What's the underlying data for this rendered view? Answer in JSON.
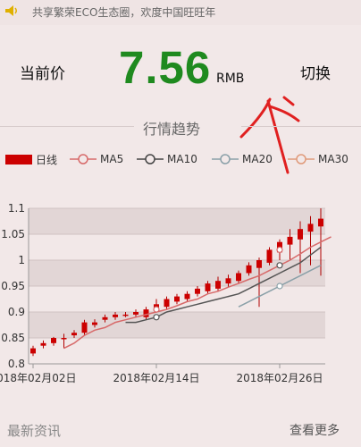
{
  "banner": {
    "text": "共享繁荣ECO生态圈，欢度中国旺旺年"
  },
  "price": {
    "label": "当前价",
    "value": "7.56",
    "unit": "RMB",
    "switch_label": "切换"
  },
  "section": {
    "title": "行情趋势"
  },
  "legend": [
    {
      "label": "日线",
      "color": "#cc0000",
      "kind": "bar"
    },
    {
      "label": "MA5",
      "color": "#d76a6a",
      "kind": "line"
    },
    {
      "label": "MA10",
      "color": "#444444",
      "kind": "line"
    },
    {
      "label": "MA20",
      "color": "#8aa0a8",
      "kind": "line"
    },
    {
      "label": "MA30",
      "color": "#e09a7a",
      "kind": "line"
    }
  ],
  "chart_data": {
    "type": "candlestick",
    "ylim": [
      0.8,
      1.1
    ],
    "yticks": [
      "1.1",
      "1.05",
      "1",
      "0.95",
      "0.9",
      "0.85",
      "0.8"
    ],
    "xticks": [
      {
        "index": 0,
        "label": "2018年02月02日"
      },
      {
        "index": 12,
        "label": "2018年02月14日"
      },
      {
        "index": 24,
        "label": "2018年02月26日"
      }
    ],
    "candles": [
      {
        "o": 0.82,
        "c": 0.83,
        "h": 0.835,
        "l": 0.815
      },
      {
        "o": 0.835,
        "c": 0.84,
        "h": 0.845,
        "l": 0.83
      },
      {
        "o": 0.84,
        "c": 0.85,
        "h": 0.852,
        "l": 0.835
      },
      {
        "o": 0.85,
        "c": 0.85,
        "h": 0.858,
        "l": 0.83
      },
      {
        "o": 0.855,
        "c": 0.86,
        "h": 0.865,
        "l": 0.85
      },
      {
        "o": 0.86,
        "c": 0.88,
        "h": 0.885,
        "l": 0.855
      },
      {
        "o": 0.875,
        "c": 0.88,
        "h": 0.886,
        "l": 0.87
      },
      {
        "o": 0.885,
        "c": 0.89,
        "h": 0.895,
        "l": 0.88
      },
      {
        "o": 0.89,
        "c": 0.895,
        "h": 0.9,
        "l": 0.885
      },
      {
        "o": 0.895,
        "c": 0.895,
        "h": 0.9,
        "l": 0.89
      },
      {
        "o": 0.895,
        "c": 0.9,
        "h": 0.905,
        "l": 0.89
      },
      {
        "o": 0.89,
        "c": 0.905,
        "h": 0.91,
        "l": 0.885
      },
      {
        "o": 0.905,
        "c": 0.915,
        "h": 0.925,
        "l": 0.9
      },
      {
        "o": 0.91,
        "c": 0.925,
        "h": 0.93,
        "l": 0.905
      },
      {
        "o": 0.92,
        "c": 0.93,
        "h": 0.935,
        "l": 0.915
      },
      {
        "o": 0.925,
        "c": 0.935,
        "h": 0.94,
        "l": 0.92
      },
      {
        "o": 0.935,
        "c": 0.945,
        "h": 0.95,
        "l": 0.93
      },
      {
        "o": 0.94,
        "c": 0.955,
        "h": 0.96,
        "l": 0.935
      },
      {
        "o": 0.945,
        "c": 0.96,
        "h": 0.968,
        "l": 0.94
      },
      {
        "o": 0.955,
        "c": 0.965,
        "h": 0.972,
        "l": 0.948
      },
      {
        "o": 0.96,
        "c": 0.975,
        "h": 0.98,
        "l": 0.955
      },
      {
        "o": 0.975,
        "c": 0.99,
        "h": 0.996,
        "l": 0.97
      },
      {
        "o": 0.985,
        "c": 1.0,
        "h": 1.005,
        "l": 0.91
      },
      {
        "o": 0.995,
        "c": 1.02,
        "h": 1.025,
        "l": 0.99
      },
      {
        "o": 1.015,
        "c": 1.035,
        "h": 1.04,
        "l": 1.0
      },
      {
        "o": 1.03,
        "c": 1.045,
        "h": 1.06,
        "l": 1.0
      },
      {
        "o": 1.04,
        "c": 1.06,
        "h": 1.075,
        "l": 0.975
      },
      {
        "o": 1.055,
        "c": 1.07,
        "h": 1.085,
        "l": 0.99
      },
      {
        "o": 1.065,
        "c": 1.08,
        "h": 1.1,
        "l": 0.97
      }
    ],
    "series": [
      {
        "name": "MA5",
        "color": "#d76a6a",
        "start": 3,
        "values": [
          0.83,
          0.84,
          0.855,
          0.865,
          0.87,
          0.88,
          0.885,
          0.89,
          0.895,
          0.9,
          0.905,
          0.912,
          0.92,
          0.925,
          0.935,
          0.94,
          0.948,
          0.955,
          0.963,
          0.97,
          0.98,
          0.99,
          1.0,
          1.012,
          1.025,
          1.035,
          1.045
        ]
      },
      {
        "name": "MA10",
        "color": "#555555",
        "start": 9,
        "values": [
          0.88,
          0.88,
          0.885,
          0.89,
          0.9,
          0.905,
          0.91,
          0.915,
          0.92,
          0.925,
          0.93,
          0.935,
          0.945,
          0.955,
          0.965,
          0.975,
          0.985,
          0.995,
          1.01,
          1.025
        ]
      },
      {
        "name": "MA20",
        "color": "#8aa0a8",
        "start": 20,
        "values": [
          0.91,
          0.92,
          0.93,
          0.94,
          0.95,
          0.96,
          0.97,
          0.98,
          0.99
        ]
      }
    ],
    "markers": [
      {
        "series": 1,
        "x": 12,
        "y": 0.89
      },
      {
        "series": 1,
        "x": 24,
        "y": 0.99
      },
      {
        "series": 0,
        "x": 24,
        "y": 1.02
      },
      {
        "series": 0,
        "x": 12,
        "y": 0.905
      },
      {
        "series": 2,
        "x": 24,
        "y": 0.95
      }
    ]
  },
  "footer": {
    "news_label": "最新资讯",
    "more_label": "查看更多"
  }
}
